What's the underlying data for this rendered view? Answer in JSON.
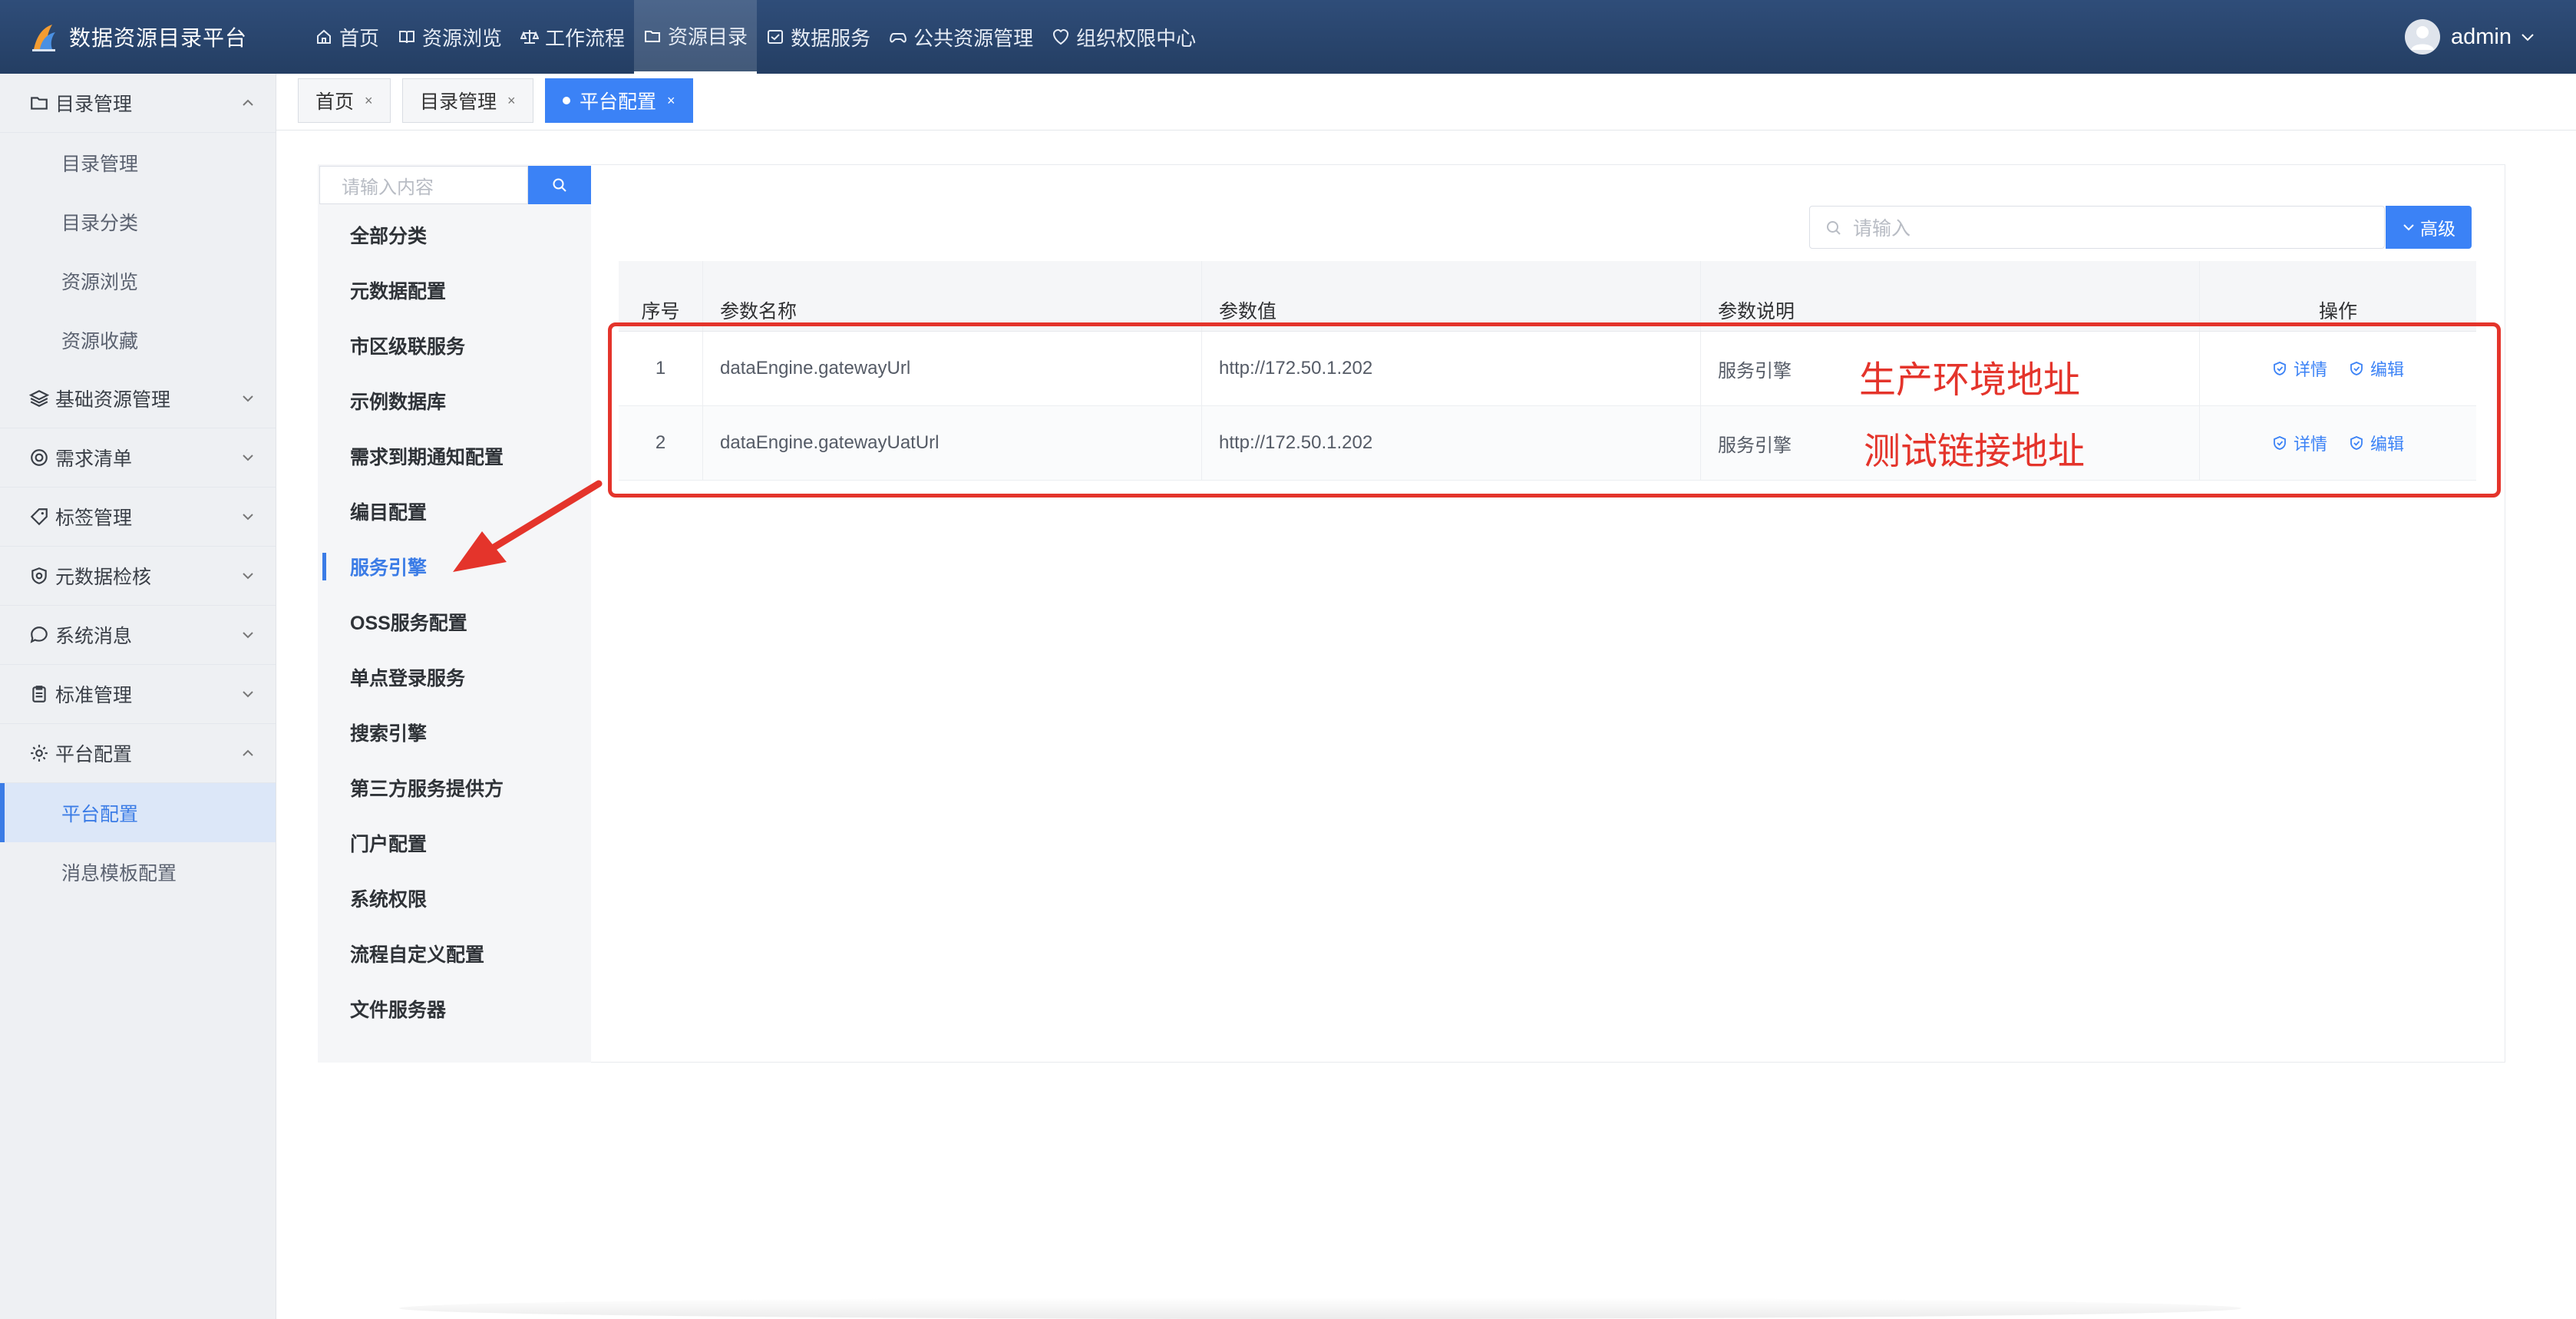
{
  "app": {
    "title": "数据资源目录平台"
  },
  "topnav": {
    "items": [
      {
        "label": "首页",
        "icon": "home-icon"
      },
      {
        "label": "资源浏览",
        "icon": "book-icon"
      },
      {
        "label": "工作流程",
        "icon": "scale-icon"
      },
      {
        "label": "资源目录",
        "icon": "folder-icon",
        "active": true
      },
      {
        "label": "数据服务",
        "icon": "checkbox-icon"
      },
      {
        "label": "公共资源管理",
        "icon": "gamepad-icon"
      },
      {
        "label": "组织权限中心",
        "icon": "heart-shield-icon"
      }
    ],
    "user": "admin"
  },
  "sidebar": {
    "groups": [
      {
        "label": "目录管理",
        "expanded": true,
        "children": [
          "目录管理",
          "目录分类",
          "资源浏览",
          "资源收藏"
        ]
      },
      {
        "label": "基础资源管理"
      },
      {
        "label": "需求清单"
      },
      {
        "label": "标签管理"
      },
      {
        "label": "元数据检核"
      },
      {
        "label": "系统消息"
      },
      {
        "label": "标准管理"
      },
      {
        "label": "平台配置",
        "expanded": true,
        "children": [
          "平台配置",
          "消息模板配置"
        ],
        "active_child": "平台配置"
      }
    ]
  },
  "tabs": [
    {
      "label": "首页"
    },
    {
      "label": "目录管理"
    },
    {
      "label": "平台配置",
      "active": true
    }
  ],
  "category_panel": {
    "search_placeholder": "请输入内容",
    "items": [
      "全部分类",
      "元数据配置",
      "市区级联服务",
      "示例数据库",
      "需求到期通知配置",
      "编目配置",
      "服务引擎",
      "OSS服务配置",
      "单点登录服务",
      "搜索引擎",
      "第三方服务提供方",
      "门户配置",
      "系统权限",
      "流程自定义配置",
      "文件服务器"
    ],
    "active": "服务引擎"
  },
  "main": {
    "search_placeholder": "请输入",
    "advanced_label": "高级",
    "table": {
      "headers": [
        "序号",
        "参数名称",
        "参数值",
        "参数说明",
        "操作"
      ],
      "rows": [
        {
          "index": "1",
          "name": "dataEngine.gatewayUrl",
          "value": "http://172.50.1.202",
          "desc": "服务引擎"
        },
        {
          "index": "2",
          "name": "dataEngine.gatewayUatUrl",
          "value": "http://172.50.1.202",
          "desc": "服务引擎"
        }
      ],
      "actions": {
        "detail": "详情",
        "edit": "编辑"
      }
    }
  },
  "annotations": {
    "label_1": "生产环境地址",
    "label_2": "测试链接地址",
    "color": "#e4342b"
  },
  "colors": {
    "accent": "#3b82f6",
    "header": "#2b4670"
  }
}
